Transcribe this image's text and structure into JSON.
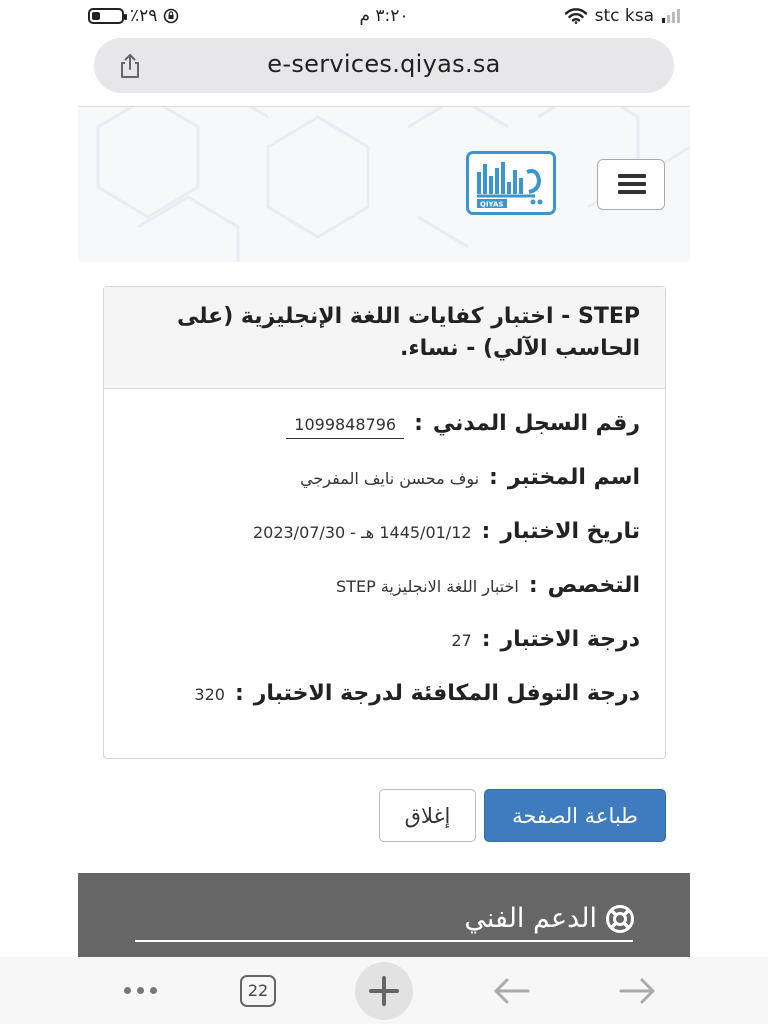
{
  "status_bar": {
    "battery_text": "٪٢٩",
    "time": "٣:٢٠ م",
    "carrier": "stc ksa",
    "battery_level": 0.29,
    "icons": [
      "battery-icon",
      "orientation-lock-icon",
      "wifi-icon",
      "signal-icon"
    ]
  },
  "browser": {
    "url": "e-services.qiyas.sa",
    "tab_count": "22",
    "icons": [
      "share-icon",
      "more-icon",
      "tabs-icon",
      "new-tab-icon",
      "back-icon",
      "forward-icon"
    ]
  },
  "site_header": {
    "logo_caption": "QIYAS",
    "icons": [
      "menu-icon"
    ]
  },
  "card": {
    "title": "STEP - اختبار كفايات اللغة الإنجليزية (على الحاسب الآلي) - نساء.",
    "fields": [
      {
        "label": "رقم السجل المدني",
        "value": "1099848796"
      },
      {
        "label": "اسم المختبر",
        "value": "نوف محسن نايف المفرجي"
      },
      {
        "label": "تاريخ الاختبار",
        "value": "1445/01/12 هـ - 2023/07/30"
      },
      {
        "label": "التخصص",
        "value": "اختبار اللغة الانجليزية STEP"
      },
      {
        "label": "درجة الاختبار",
        "value": "27"
      },
      {
        "label": "درجة التوفل المكافئة لدرجة الاختبار",
        "value": "320"
      }
    ],
    "colon": ":"
  },
  "actions": {
    "print_label": "طباعة الصفحة",
    "close_label": "إغلاق",
    "print_color": "#3f7bbf"
  },
  "support": {
    "title": "الدعم الفني",
    "icon": "lifebuoy-icon",
    "background": "#666666"
  }
}
